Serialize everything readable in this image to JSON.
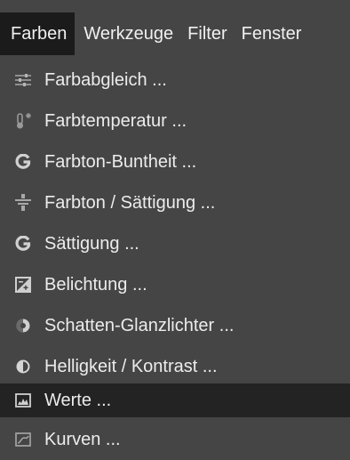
{
  "menubar": {
    "items": [
      {
        "label": "Farben"
      },
      {
        "label": "Werkzeuge"
      },
      {
        "label": "Filter"
      },
      {
        "label": "Fenster"
      }
    ]
  },
  "dropdown": {
    "items": [
      {
        "label": "Farbabgleich ...",
        "icon": "color-balance-icon"
      },
      {
        "label": "Farbtemperatur ...",
        "icon": "thermometer-icon"
      },
      {
        "label": "Farbton-Buntheit ...",
        "icon": "g-icon"
      },
      {
        "label": "Farbton / Sättigung ...",
        "icon": "hue-saturation-icon"
      },
      {
        "label": "Sättigung ...",
        "icon": "g-icon"
      },
      {
        "label": "Belichtung ...",
        "icon": "exposure-icon"
      },
      {
        "label": "Schatten-Glanzlichter ...",
        "icon": "shadows-highlights-icon"
      },
      {
        "label": "Helligkeit / Kontrast ...",
        "icon": "brightness-contrast-icon"
      },
      {
        "label": "Werte ...",
        "icon": "levels-icon",
        "highlighted": true
      },
      {
        "label": "Kurven ...",
        "icon": "curves-icon"
      }
    ]
  }
}
